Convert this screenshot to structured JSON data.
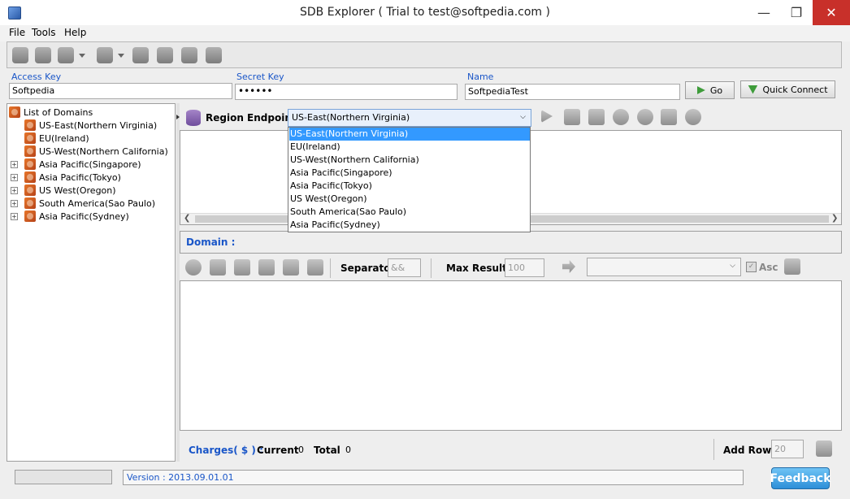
{
  "window": {
    "title": "SDB Explorer  ( Trial to test@softpedia.com )"
  },
  "menu": [
    "File",
    "Tools",
    "Help"
  ],
  "credentials": {
    "access_key_label": "Access Key",
    "access_key_value": "Softpedia",
    "secret_key_label": "Secret Key",
    "secret_key_value": "••••••",
    "name_label": "Name",
    "name_value": "SoftpediaTest",
    "go_label": "Go",
    "quick_connect_label": "Quick Connect"
  },
  "tree": {
    "root": "List of Domains",
    "items": [
      "US-East(Northern Virginia)",
      "EU(Ireland)",
      "US-West(Northern California)",
      "Asia Pacific(Singapore)",
      "Asia Pacific(Tokyo)",
      "US West(Oregon)",
      "South America(Sao Paulo)",
      "Asia Pacific(Sydney)"
    ]
  },
  "region": {
    "label": "Region Endpoint",
    "selected": "US-East(Northern Virginia)",
    "options": [
      "US-East(Northern Virginia)",
      "EU(Ireland)",
      "US-West(Northern California)",
      "Asia Pacific(Singapore)",
      "Asia Pacific(Tokyo)",
      "US West(Oregon)",
      "South America(Sao Paulo)",
      "Asia Pacific(Sydney)"
    ]
  },
  "domain": {
    "label": "Domain :"
  },
  "query": {
    "separator_label": "Separator",
    "separator_value": "&&",
    "max_results_label": "Max Results",
    "max_results_value": "100",
    "asc_label": "Asc"
  },
  "charges": {
    "label": "Charges( $ ) :",
    "current_label": "Current",
    "current_value": "0",
    "total_label": "Total",
    "total_value": "0",
    "add_rows_label": "Add Rows",
    "add_rows_value": "20"
  },
  "status": {
    "version": "Version : 2013.09.01.01",
    "feedback_label": "Feedback"
  },
  "colors": {
    "accent_blue": "#1a56c8",
    "selection": "#3399ff",
    "close_red": "#c8302a",
    "db_orange": "#e7762a"
  }
}
